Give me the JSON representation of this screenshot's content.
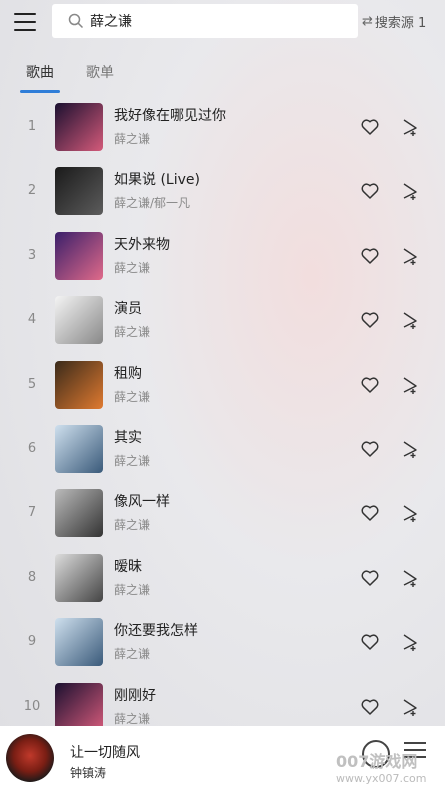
{
  "search": {
    "query": "薛之谦",
    "source_label": "搜索源 1"
  },
  "tabs": [
    {
      "label": "歌曲",
      "active": true
    },
    {
      "label": "歌单",
      "active": false
    }
  ],
  "songs": [
    {
      "index": "1",
      "title": "我好像在哪见过你",
      "artist": "薛之谦",
      "cover": [
        "#1b1030",
        "#d45a7a"
      ]
    },
    {
      "index": "2",
      "title": "如果说 (Live)",
      "artist": "薛之谦/郁一凡",
      "cover": [
        "#1a1a1a",
        "#5c5c5c"
      ]
    },
    {
      "index": "3",
      "title": "天外来物",
      "artist": "薛之谦",
      "cover": [
        "#3a1f6a",
        "#e06a8a"
      ]
    },
    {
      "index": "4",
      "title": "演员",
      "artist": "薛之谦",
      "cover": [
        "#f4f4f4",
        "#888888"
      ]
    },
    {
      "index": "5",
      "title": "租购",
      "artist": "薛之谦",
      "cover": [
        "#3a2a1a",
        "#e07a30"
      ]
    },
    {
      "index": "6",
      "title": "其实",
      "artist": "薛之谦",
      "cover": [
        "#cfe0ee",
        "#3a5a7a"
      ]
    },
    {
      "index": "7",
      "title": "像风一样",
      "artist": "薛之谦",
      "cover": [
        "#bbbbbb",
        "#333333"
      ]
    },
    {
      "index": "8",
      "title": "暧昧",
      "artist": "薛之谦",
      "cover": [
        "#dddddd",
        "#444444"
      ]
    },
    {
      "index": "9",
      "title": "你还要我怎样",
      "artist": "薛之谦",
      "cover": [
        "#cfe0ee",
        "#3a5a7a"
      ]
    },
    {
      "index": "10",
      "title": "刚刚好",
      "artist": "薛之谦",
      "cover": [
        "#1b1030",
        "#d45a7a"
      ]
    }
  ],
  "player": {
    "title": "让一切随风",
    "artist": "钟镇涛"
  },
  "watermark": {
    "main": "007游戏网",
    "sub": "www.yx007.com"
  },
  "colors": {
    "accent": "#2f7dd8"
  }
}
